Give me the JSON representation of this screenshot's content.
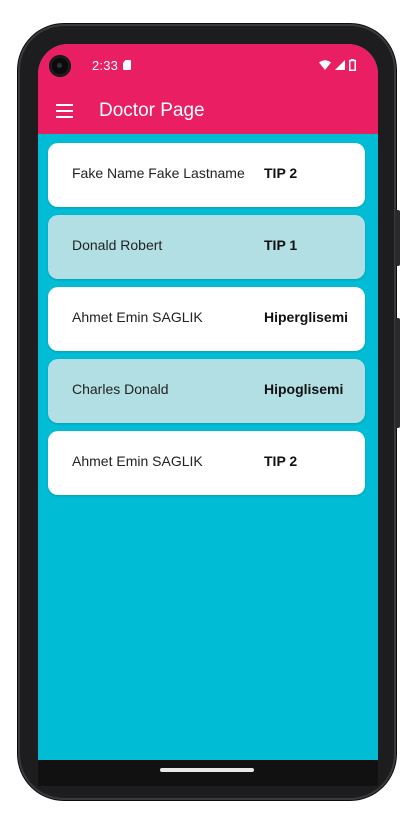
{
  "status_bar": {
    "time": "2:33",
    "icons": [
      "sim-card-icon",
      "wifi-icon",
      "signal-icon",
      "battery-icon"
    ]
  },
  "app_bar": {
    "menu_icon": "menu-icon",
    "title": "Doctor Page"
  },
  "patients": [
    {
      "name": "Fake Name Fake Lastname",
      "diagnosis": "TIP 2"
    },
    {
      "name": "Donald Robert",
      "diagnosis": "TIP 1"
    },
    {
      "name": "Ahmet Emin SAGLIK",
      "diagnosis": "Hiperglisemi"
    },
    {
      "name": "Charles Donald",
      "diagnosis": "Hipoglisemi"
    },
    {
      "name": "Ahmet Emin SAGLIK",
      "diagnosis": "TIP 2"
    }
  ],
  "colors": {
    "primary": "#e91e63",
    "background": "#00bcd4",
    "card": "#ffffff",
    "card_alt": "#b2dfe4"
  }
}
